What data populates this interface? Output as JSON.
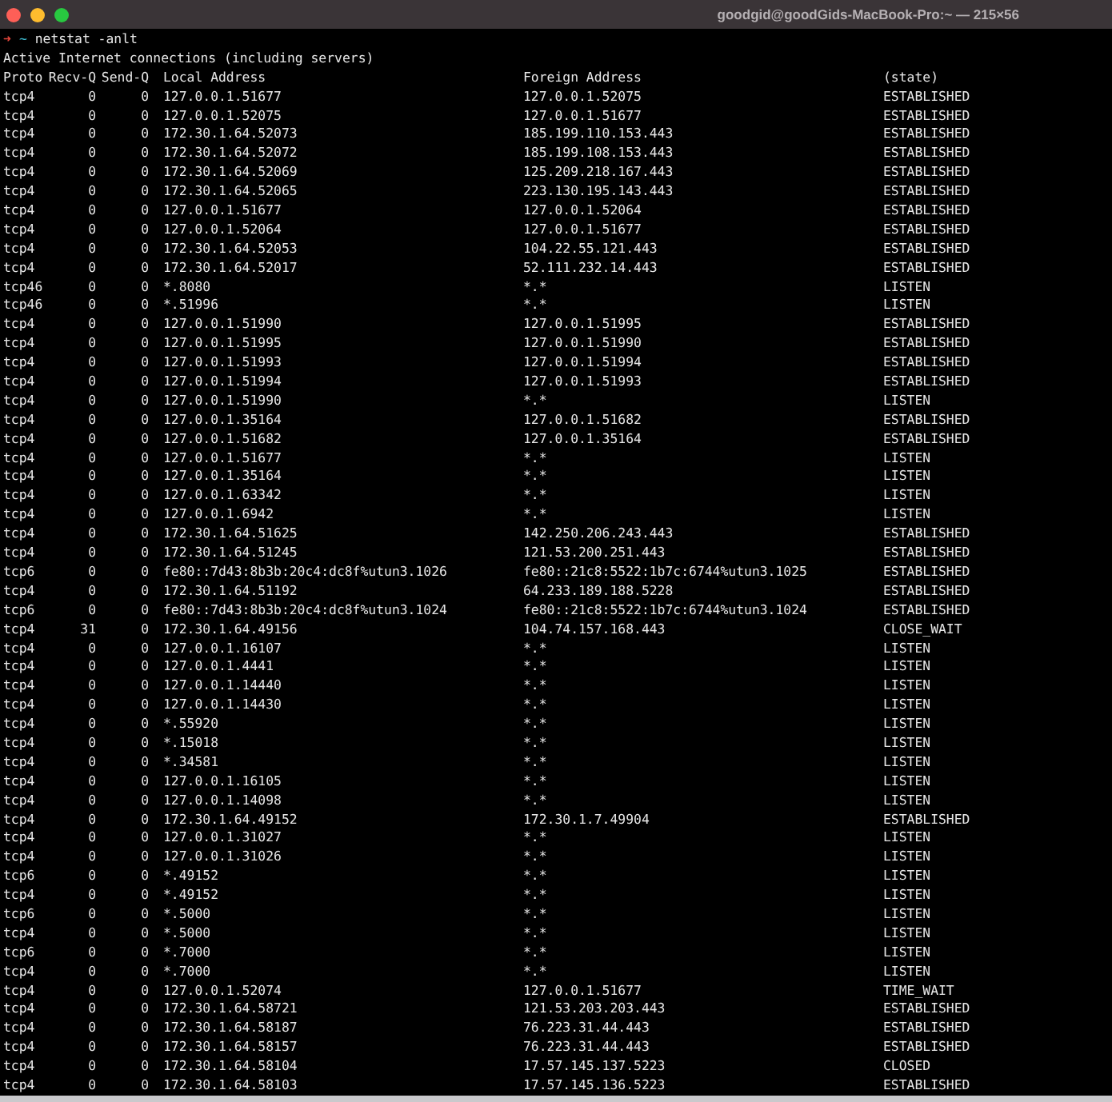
{
  "window": {
    "title": "goodgid@goodGids-MacBook-Pro:~ — 215×56"
  },
  "prompt": {
    "arrow": "➜",
    "cwd": "~",
    "command": "netstat -anlt"
  },
  "output_heading": "Active Internet connections (including servers)",
  "table": {
    "columns": [
      "Proto",
      "Recv-Q",
      "Send-Q",
      "Local Address",
      "Foreign Address",
      "(state)"
    ],
    "rows": [
      [
        "tcp4",
        "0",
        "0",
        "127.0.0.1.51677",
        "127.0.0.1.52075",
        "ESTABLISHED"
      ],
      [
        "tcp4",
        "0",
        "0",
        "127.0.0.1.52075",
        "127.0.0.1.51677",
        "ESTABLISHED"
      ],
      [
        "tcp4",
        "0",
        "0",
        "172.30.1.64.52073",
        "185.199.110.153.443",
        "ESTABLISHED"
      ],
      [
        "tcp4",
        "0",
        "0",
        "172.30.1.64.52072",
        "185.199.108.153.443",
        "ESTABLISHED"
      ],
      [
        "tcp4",
        "0",
        "0",
        "172.30.1.64.52069",
        "125.209.218.167.443",
        "ESTABLISHED"
      ],
      [
        "tcp4",
        "0",
        "0",
        "172.30.1.64.52065",
        "223.130.195.143.443",
        "ESTABLISHED"
      ],
      [
        "tcp4",
        "0",
        "0",
        "127.0.0.1.51677",
        "127.0.0.1.52064",
        "ESTABLISHED"
      ],
      [
        "tcp4",
        "0",
        "0",
        "127.0.0.1.52064",
        "127.0.0.1.51677",
        "ESTABLISHED"
      ],
      [
        "tcp4",
        "0",
        "0",
        "172.30.1.64.52053",
        "104.22.55.121.443",
        "ESTABLISHED"
      ],
      [
        "tcp4",
        "0",
        "0",
        "172.30.1.64.52017",
        "52.111.232.14.443",
        "ESTABLISHED"
      ],
      [
        "tcp46",
        "0",
        "0",
        "*.8080",
        "*.*",
        "LISTEN"
      ],
      [
        "tcp46",
        "0",
        "0",
        "*.51996",
        "*.*",
        "LISTEN"
      ],
      [
        "tcp4",
        "0",
        "0",
        "127.0.0.1.51990",
        "127.0.0.1.51995",
        "ESTABLISHED"
      ],
      [
        "tcp4",
        "0",
        "0",
        "127.0.0.1.51995",
        "127.0.0.1.51990",
        "ESTABLISHED"
      ],
      [
        "tcp4",
        "0",
        "0",
        "127.0.0.1.51993",
        "127.0.0.1.51994",
        "ESTABLISHED"
      ],
      [
        "tcp4",
        "0",
        "0",
        "127.0.0.1.51994",
        "127.0.0.1.51993",
        "ESTABLISHED"
      ],
      [
        "tcp4",
        "0",
        "0",
        "127.0.0.1.51990",
        "*.*",
        "LISTEN"
      ],
      [
        "tcp4",
        "0",
        "0",
        "127.0.0.1.35164",
        "127.0.0.1.51682",
        "ESTABLISHED"
      ],
      [
        "tcp4",
        "0",
        "0",
        "127.0.0.1.51682",
        "127.0.0.1.35164",
        "ESTABLISHED"
      ],
      [
        "tcp4",
        "0",
        "0",
        "127.0.0.1.51677",
        "*.*",
        "LISTEN"
      ],
      [
        "tcp4",
        "0",
        "0",
        "127.0.0.1.35164",
        "*.*",
        "LISTEN"
      ],
      [
        "tcp4",
        "0",
        "0",
        "127.0.0.1.63342",
        "*.*",
        "LISTEN"
      ],
      [
        "tcp4",
        "0",
        "0",
        "127.0.0.1.6942",
        "*.*",
        "LISTEN"
      ],
      [
        "tcp4",
        "0",
        "0",
        "172.30.1.64.51625",
        "142.250.206.243.443",
        "ESTABLISHED"
      ],
      [
        "tcp4",
        "0",
        "0",
        "172.30.1.64.51245",
        "121.53.200.251.443",
        "ESTABLISHED"
      ],
      [
        "tcp6",
        "0",
        "0",
        "fe80::7d43:8b3b:20c4:dc8f%utun3.1026",
        "fe80::21c8:5522:1b7c:6744%utun3.1025",
        "ESTABLISHED"
      ],
      [
        "tcp4",
        "0",
        "0",
        "172.30.1.64.51192",
        "64.233.189.188.5228",
        "ESTABLISHED"
      ],
      [
        "tcp6",
        "0",
        "0",
        "fe80::7d43:8b3b:20c4:dc8f%utun3.1024",
        "fe80::21c8:5522:1b7c:6744%utun3.1024",
        "ESTABLISHED"
      ],
      [
        "tcp4",
        "31",
        "0",
        "172.30.1.64.49156",
        "104.74.157.168.443",
        "CLOSE_WAIT"
      ],
      [
        "tcp4",
        "0",
        "0",
        "127.0.0.1.16107",
        "*.*",
        "LISTEN"
      ],
      [
        "tcp4",
        "0",
        "0",
        "127.0.0.1.4441",
        "*.*",
        "LISTEN"
      ],
      [
        "tcp4",
        "0",
        "0",
        "127.0.0.1.14440",
        "*.*",
        "LISTEN"
      ],
      [
        "tcp4",
        "0",
        "0",
        "127.0.0.1.14430",
        "*.*",
        "LISTEN"
      ],
      [
        "tcp4",
        "0",
        "0",
        "*.55920",
        "*.*",
        "LISTEN"
      ],
      [
        "tcp4",
        "0",
        "0",
        "*.15018",
        "*.*",
        "LISTEN"
      ],
      [
        "tcp4",
        "0",
        "0",
        "*.34581",
        "*.*",
        "LISTEN"
      ],
      [
        "tcp4",
        "0",
        "0",
        "127.0.0.1.16105",
        "*.*",
        "LISTEN"
      ],
      [
        "tcp4",
        "0",
        "0",
        "127.0.0.1.14098",
        "*.*",
        "LISTEN"
      ],
      [
        "tcp4",
        "0",
        "0",
        "172.30.1.64.49152",
        "172.30.1.7.49904",
        "ESTABLISHED"
      ],
      [
        "tcp4",
        "0",
        "0",
        "127.0.0.1.31027",
        "*.*",
        "LISTEN"
      ],
      [
        "tcp4",
        "0",
        "0",
        "127.0.0.1.31026",
        "*.*",
        "LISTEN"
      ],
      [
        "tcp6",
        "0",
        "0",
        "*.49152",
        "*.*",
        "LISTEN"
      ],
      [
        "tcp4",
        "0",
        "0",
        "*.49152",
        "*.*",
        "LISTEN"
      ],
      [
        "tcp6",
        "0",
        "0",
        "*.5000",
        "*.*",
        "LISTEN"
      ],
      [
        "tcp4",
        "0",
        "0",
        "*.5000",
        "*.*",
        "LISTEN"
      ],
      [
        "tcp6",
        "0",
        "0",
        "*.7000",
        "*.*",
        "LISTEN"
      ],
      [
        "tcp4",
        "0",
        "0",
        "*.7000",
        "*.*",
        "LISTEN"
      ],
      [
        "tcp4",
        "0",
        "0",
        "127.0.0.1.52074",
        "127.0.0.1.51677",
        "TIME_WAIT"
      ],
      [
        "tcp4",
        "0",
        "0",
        "172.30.1.64.58721",
        "121.53.203.203.443",
        "ESTABLISHED"
      ],
      [
        "tcp4",
        "0",
        "0",
        "172.30.1.64.58187",
        "76.223.31.44.443",
        "ESTABLISHED"
      ],
      [
        "tcp4",
        "0",
        "0",
        "172.30.1.64.58157",
        "76.223.31.44.443",
        "ESTABLISHED"
      ],
      [
        "tcp4",
        "0",
        "0",
        "172.30.1.64.58104",
        "17.57.145.137.5223",
        "CLOSED"
      ],
      [
        "tcp4",
        "0",
        "0",
        "172.30.1.64.58103",
        "17.57.145.136.5223",
        "ESTABLISHED"
      ]
    ]
  }
}
